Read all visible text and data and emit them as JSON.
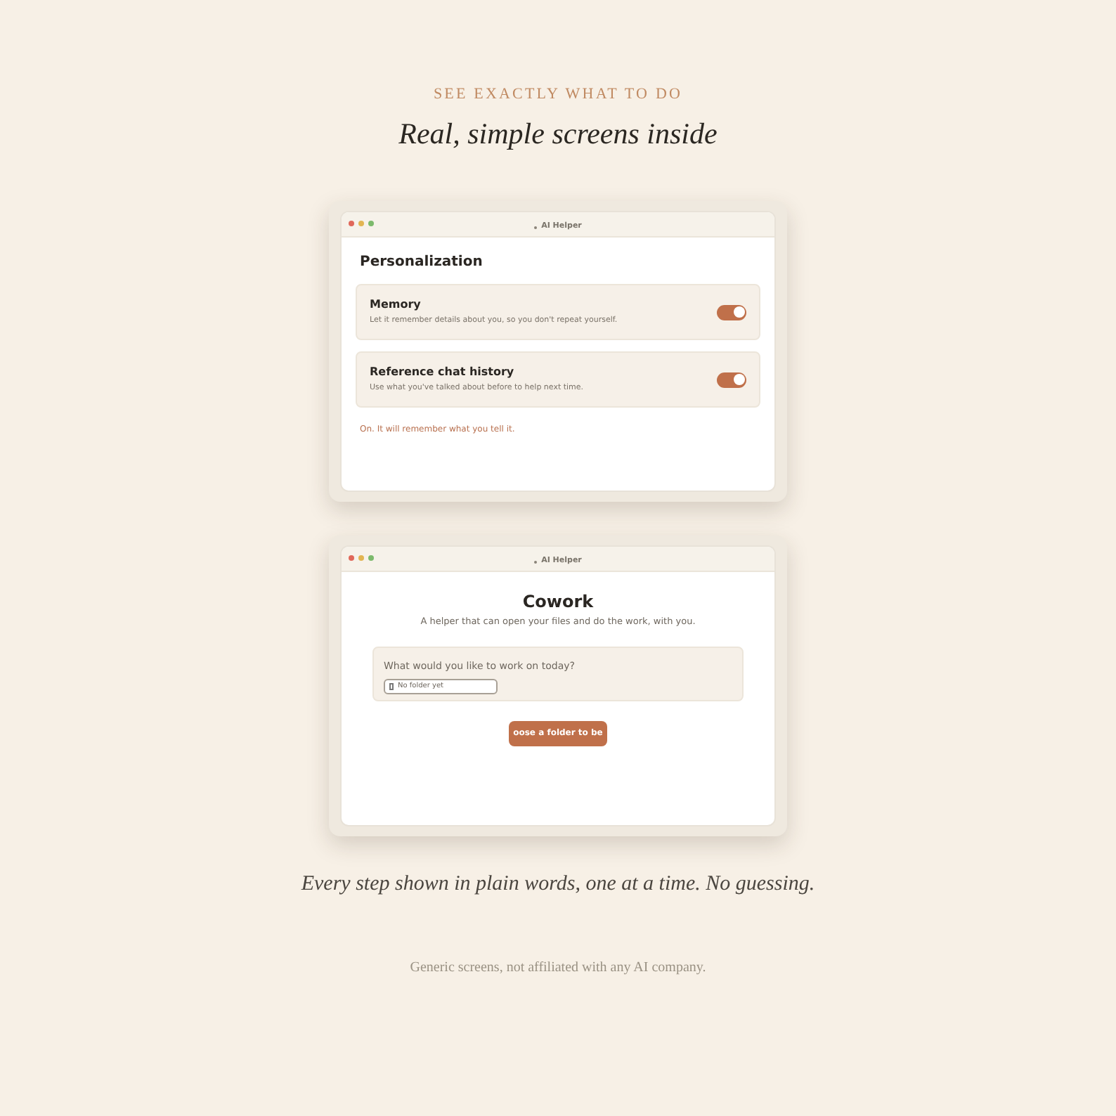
{
  "header": {
    "eyebrow": "SEE EXACTLY WHAT TO DO",
    "title": "Real, simple screens inside"
  },
  "screens": [
    {
      "kind": "settings",
      "window": {
        "title": "AI Helper"
      },
      "heading": "Personalization",
      "settings": [
        {
          "name": "Memory",
          "description": "Let it remember details about you, so you don't repeat yourself.",
          "on": true
        },
        {
          "name": "Reference chat history",
          "description": "Use what you've talked about before to help next time.",
          "on": true
        }
      ],
      "status": "On. It will remember what you tell it."
    },
    {
      "kind": "start",
      "window": {
        "title": "AI Helper"
      },
      "heading": "Cowork",
      "subtitle": "A helper that can open your files and do the work, with you.",
      "prompt": {
        "label": "What would you like to work on today?",
        "folder_chip": "No folder yet"
      },
      "button": "oose a folder to be"
    }
  ],
  "caption": "Every step shown in plain words, one at a time. No guessing.",
  "disclaimer": "Generic screens, not affiliated with any AI company."
}
